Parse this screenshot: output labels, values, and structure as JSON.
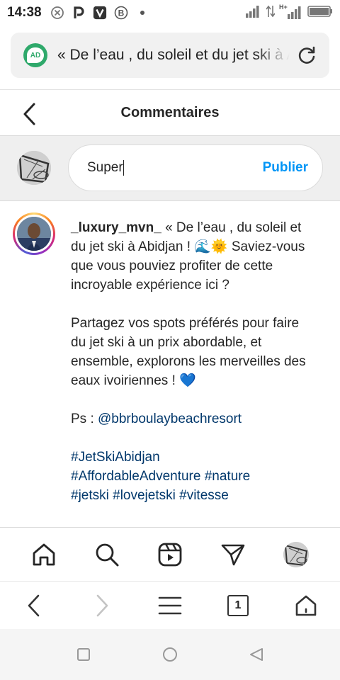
{
  "status_bar": {
    "time": "14:38",
    "network_label": "H+",
    "notification_icons": [
      "blocked-notification-icon",
      "p-app-icon",
      "v-app-icon",
      "b-app-icon",
      "dot-icon"
    ]
  },
  "browser": {
    "url_text": "« De l’eau , du soleil et du jet ski à Abidjan",
    "ad_badge": "AD",
    "tab_count": "1"
  },
  "header": {
    "title": "Commentaires"
  },
  "comment_input": {
    "value": "Super",
    "publish_label": "Publier"
  },
  "post": {
    "username": "_luxury_mvn_",
    "paragraph1": "« De l’eau , du soleil et du jet ski à Abidjan ! 🌊🌞 Saviez-vous que vous pouviez profiter de cette incroyable expérience ici ?",
    "paragraph2": "Partagez vos spots préférés pour faire du jet ski à un prix abordable, et ensemble, explorons les merveilles des eaux ivoiriennes ! 💙",
    "ps_prefix": "Ps : ",
    "mention": "@bbrboulaybeachresort",
    "hashtags_line1": "#JetSkiAbidjan",
    "hashtags_line2": "#AffordableAdventure #nature",
    "hashtags_line3": "#jetski #lovejetski #vitesse"
  },
  "colors": {
    "accent_blue": "#0095f6",
    "link_blue": "#00376b",
    "ad_green": "#2fa96b"
  }
}
